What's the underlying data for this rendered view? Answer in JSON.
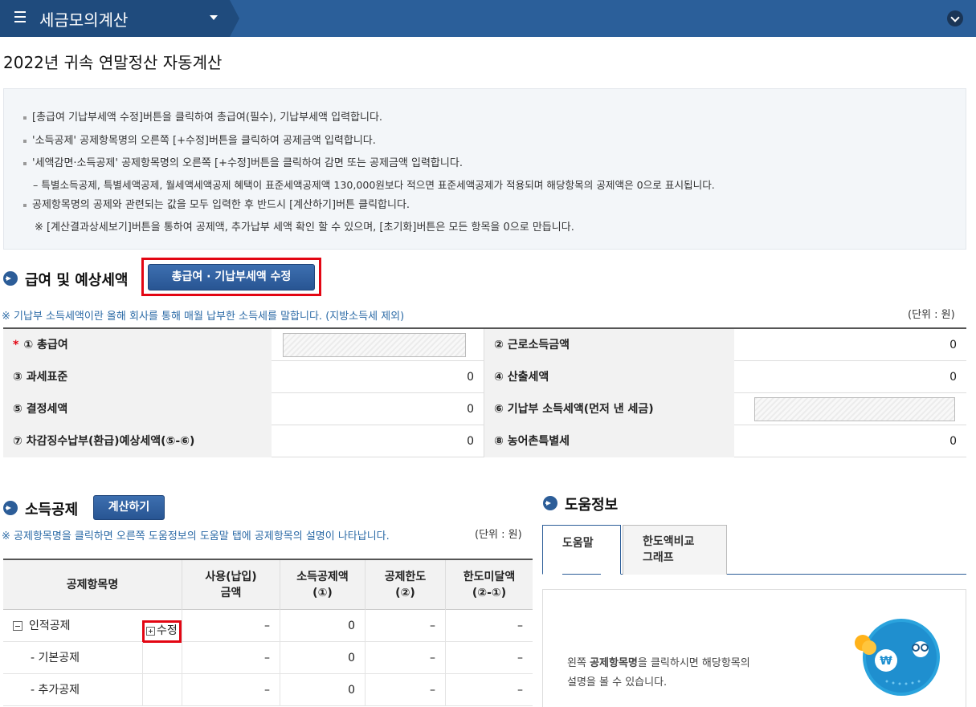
{
  "header": {
    "app_title": "세금모의계산"
  },
  "page": {
    "title": "2022년 귀속 연말정산 자동계산"
  },
  "info": {
    "lines": [
      "[총급여 기납부세액 수정]버튼을 클릭하여 총급여(필수), 기납부세액 입력합니다.",
      "'소득공제' 공제항목명의 오른쪽 [+수정]버튼을 클릭하여 공제금액 입력합니다.",
      "'세액감면·소득공제' 공제항목명의 오른쪽 [+수정]버튼을 클릭하여 감면 또는 공제금액 입력합니다.",
      "– 특별소득공제, 특별세액공제, 월세액세액공제 혜택이 표준세액공제액 130,000원보다 적으면 표준세액공제가 적용되며 해당항목의 공제액은 0으로 표시됩니다.",
      "공제항목명의 공제와 관련되는 값을 모두 입력한 후 반드시 [계산하기]버튼 클릭합니다.",
      "※ [계산결과상세보기]버튼을 통하여 공제액, 추가납부 세액 확인 할 수 있으며, [초기화]버튼은 모든 항목을 0으로 만듭니다."
    ]
  },
  "salary": {
    "title": "급여 및 예상세액",
    "edit_button": "총급여 · 기납부세액 수정",
    "note": "※ 기납부 소득세액이란 올해 회사를 통해 매월 납부한 소득세를 말합니다. (지방소득세 제외)",
    "unit": "(단위 : 원)",
    "required_mark": "*",
    "rows": [
      {
        "l1": "① 총급여",
        "v1": "",
        "l2": "② 근로소득금액",
        "v2": "0"
      },
      {
        "l1": "③ 과세표준",
        "v1": "0",
        "l2": "④ 산출세액",
        "v2": "0"
      },
      {
        "l1": "⑤ 결정세액",
        "v1": "0",
        "l2": "⑥ 기납부 소득세액(먼저 낸 세금)",
        "v2": ""
      },
      {
        "l1": "⑦ 차감징수납부(환급)예상세액(⑤-⑥)",
        "v1": "0",
        "l2": "⑧ 농어촌특별세",
        "v2": "0"
      }
    ]
  },
  "deduction": {
    "title": "소득공제",
    "calc_button": "계산하기",
    "note": "※ 공제항목명을 클릭하면 오른쪽 도움정보의 도움말 탭에 공제항목의 설명이 나타납니다.",
    "unit": "(단위 : 원)",
    "headers": [
      "공제항목명",
      "사용(납입)\n금액",
      "소득공제액\n(①)",
      "공제한도\n(②)",
      "한도미달액\n(②-①)"
    ],
    "edit_label": "수정",
    "rows": [
      {
        "name": "인적공제",
        "used": "–",
        "amount": "0",
        "limit": "–",
        "short": "–"
      },
      {
        "name": "- 기본공제",
        "used": "–",
        "amount": "0",
        "limit": "–",
        "short": "–"
      },
      {
        "name": "- 추가공제",
        "used": "–",
        "amount": "0",
        "limit": "–",
        "short": "–"
      }
    ]
  },
  "help": {
    "title": "도움정보",
    "tab_help": "도움말",
    "tab_compare_1": "한도액비교",
    "tab_compare_2": "그래프",
    "text_1": "왼쪽 ",
    "text_bold": "공제항목명",
    "text_2": "을 클릭하시면 해당항목의",
    "text_3": "설명을 볼 수 있습니다."
  },
  "colors": {
    "brand": "#2b5f9a",
    "accent_red": "#e30613",
    "note_blue": "#2b6aa6"
  }
}
